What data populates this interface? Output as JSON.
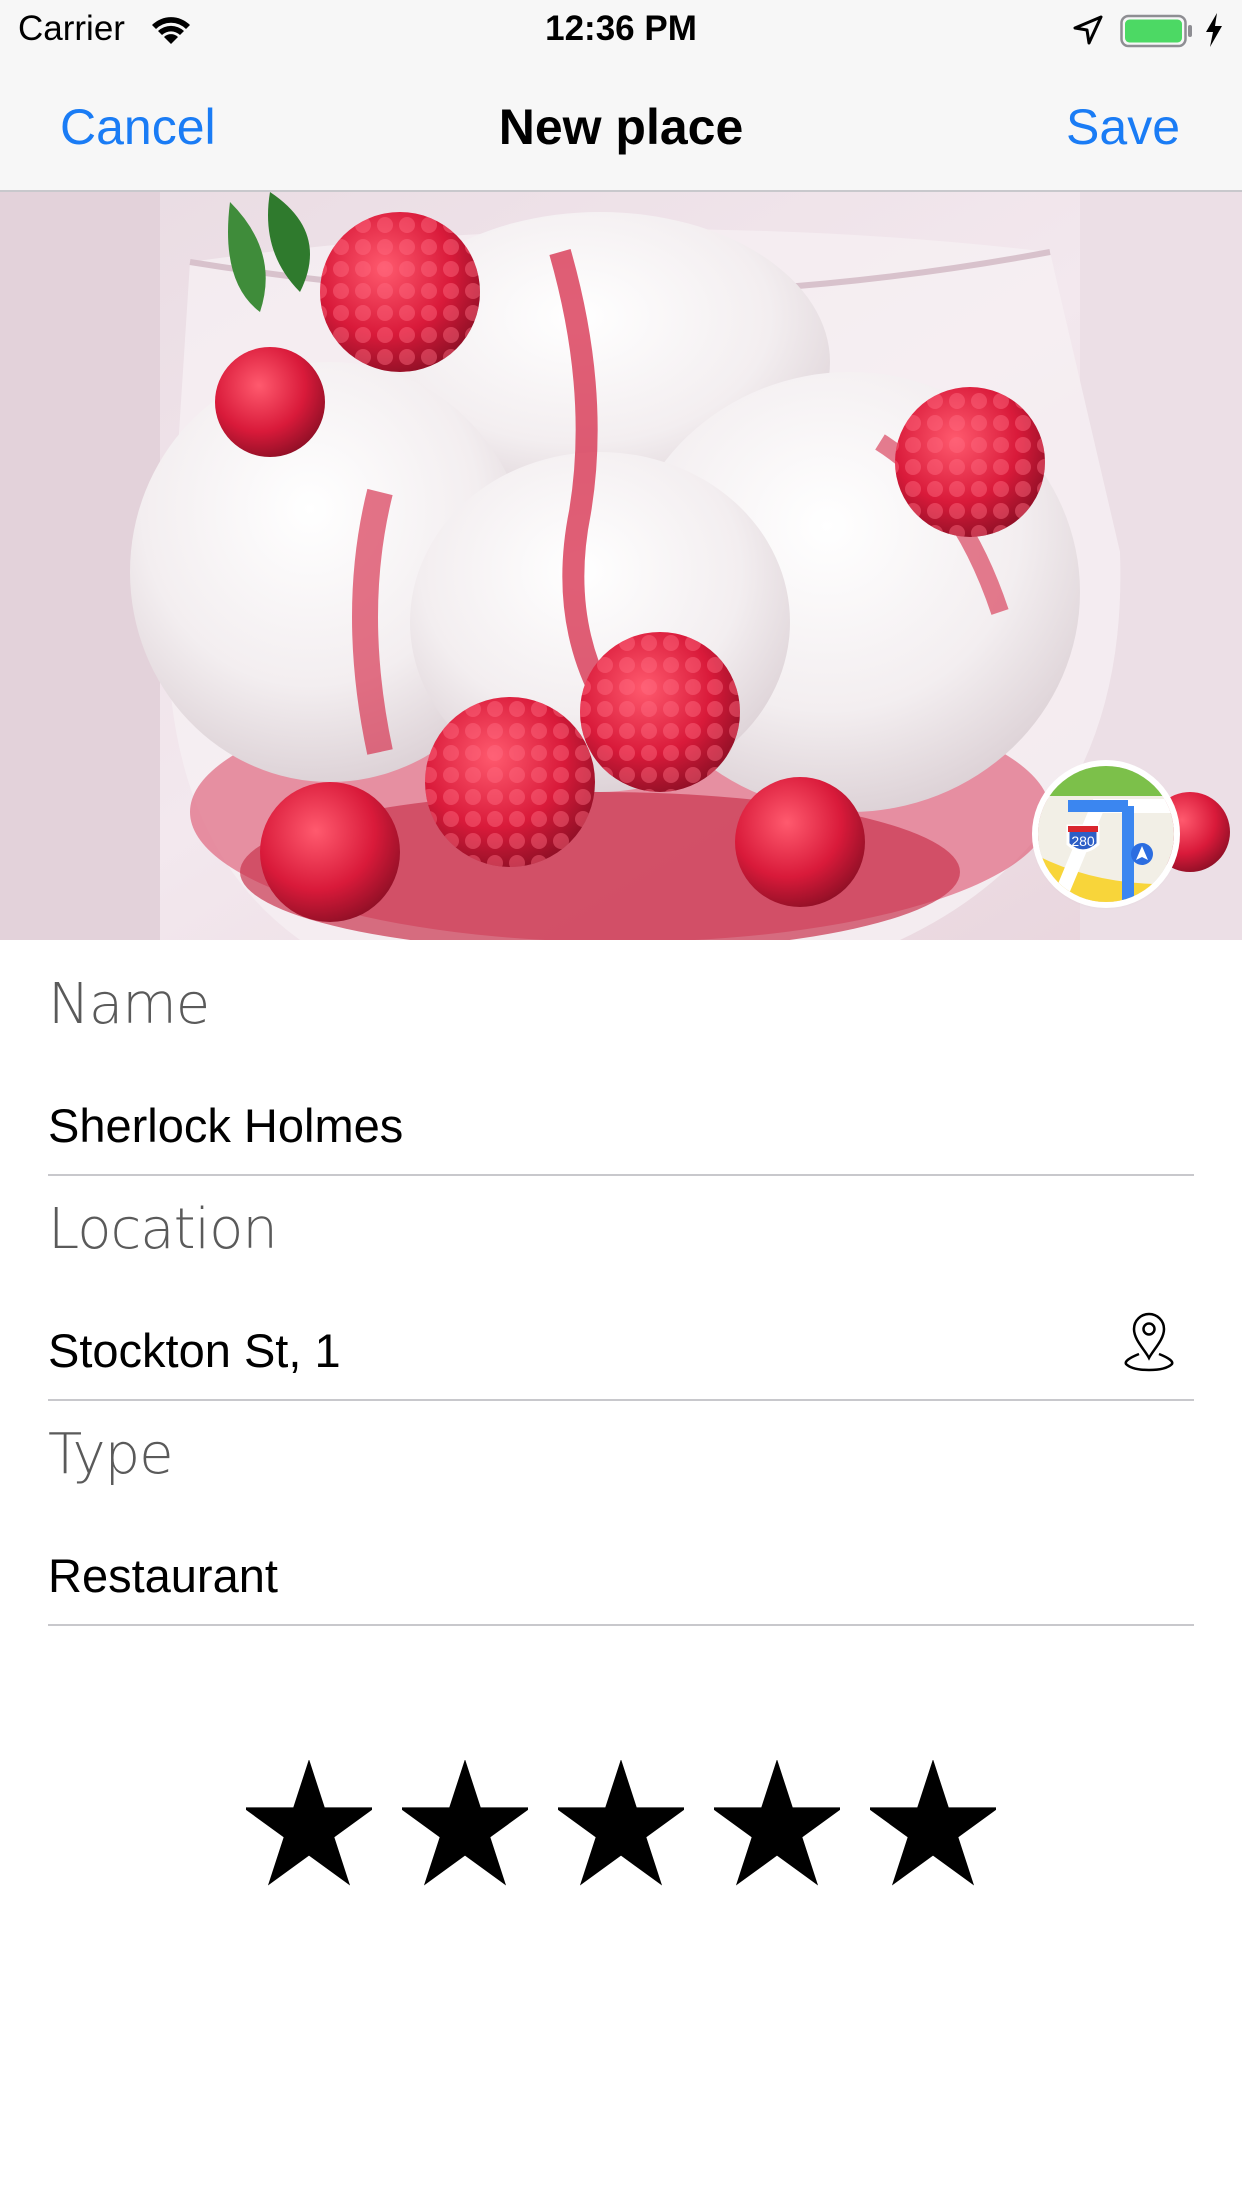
{
  "status_bar": {
    "carrier": "Carrier",
    "time": "12:36 PM",
    "icons": [
      "wifi-icon",
      "location-arrow-icon",
      "battery-icon",
      "charging-icon"
    ]
  },
  "nav": {
    "cancel_label": "Cancel",
    "title": "New place",
    "save_label": "Save"
  },
  "photo": {
    "subject": "ice cream with raspberries in glass",
    "map_button_icon": "maps-app-icon",
    "map_shield_text": "280"
  },
  "form": {
    "name": {
      "label": "Name",
      "value": "Sherlock Holmes"
    },
    "location": {
      "label": "Location",
      "value": "Stockton St, 1",
      "icon": "map-pin-icon"
    },
    "type": {
      "label": "Type",
      "value": "Restaurant"
    }
  },
  "rating": {
    "max": 5,
    "value": 5,
    "icon": "star-icon"
  },
  "colors": {
    "tint": "#1a7cf5",
    "bar_background": "#f7f7f7",
    "separator": "#c8c8cc",
    "battery": "#4cd964"
  }
}
